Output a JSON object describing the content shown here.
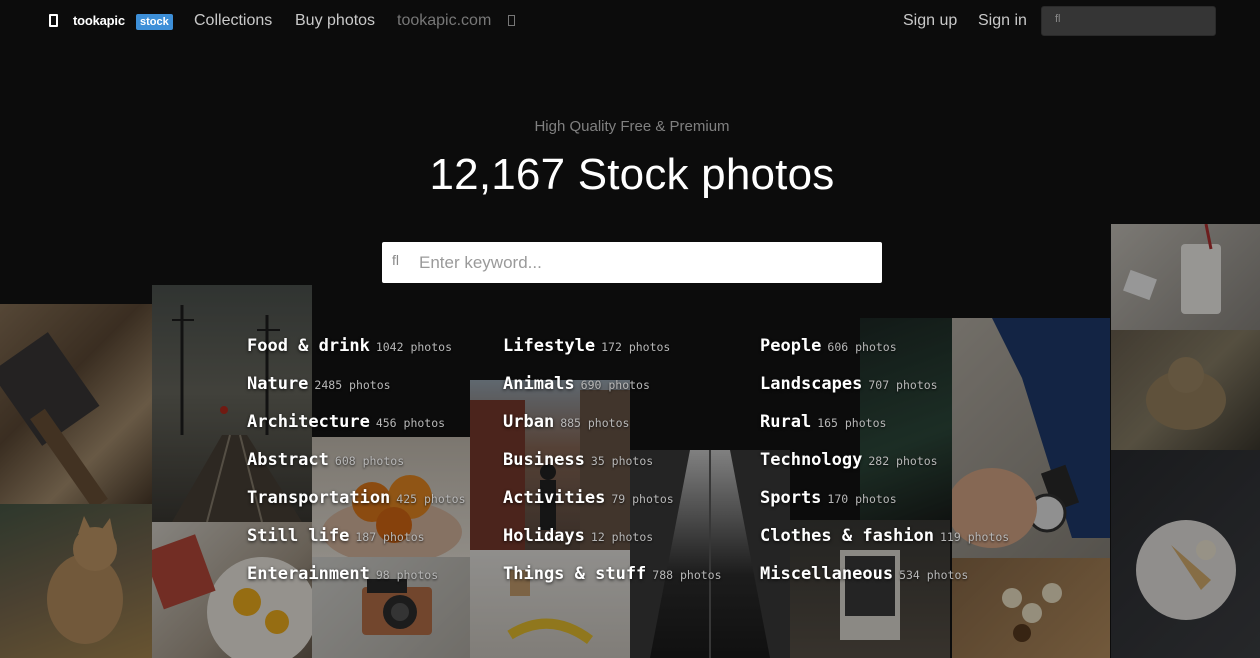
{
  "nav": {
    "brand": "tookapic",
    "badge": "stock",
    "links": [
      "Collections",
      "Buy photos"
    ],
    "external_link": "tookapic.com",
    "sign_up": "Sign up",
    "sign_in": "Sign in"
  },
  "hero": {
    "subtitle": "High Quality Free & Premium",
    "title": "12,167 Stock photos",
    "search_placeholder": "Enter keyword..."
  },
  "categories": [
    [
      {
        "name": "Food & drink",
        "count": "1042 photos"
      },
      {
        "name": "Nature",
        "count": "2485 photos"
      },
      {
        "name": "Architecture",
        "count": "456 photos"
      },
      {
        "name": "Abstract",
        "count": "608 photos"
      },
      {
        "name": "Transportation",
        "count": "425 photos"
      },
      {
        "name": "Still life",
        "count": "187 photos"
      },
      {
        "name": "Enterainment",
        "count": "98 photos"
      }
    ],
    [
      {
        "name": "Lifestyle",
        "count": "172 photos"
      },
      {
        "name": "Animals",
        "count": "690 photos"
      },
      {
        "name": "Urban",
        "count": "885 photos"
      },
      {
        "name": "Business",
        "count": "35 photos"
      },
      {
        "name": "Activities",
        "count": "79 photos"
      },
      {
        "name": "Holidays",
        "count": "12 photos"
      },
      {
        "name": "Things & stuff",
        "count": "788 photos"
      }
    ],
    [
      {
        "name": "People",
        "count": "606 photos"
      },
      {
        "name": "Landscapes",
        "count": "707 photos"
      },
      {
        "name": "Rural",
        "count": "165 photos"
      },
      {
        "name": "Technology",
        "count": "282 photos"
      },
      {
        "name": "Sports",
        "count": "170 photos"
      },
      {
        "name": "Clothes & fashion",
        "count": "119 photos"
      },
      {
        "name": "Miscellaneous",
        "count": "534 photos"
      }
    ]
  ],
  "colors": {
    "background": "#141414",
    "badge": "#3d8fd8",
    "nav_link": "#c9c9c9",
    "muted": "#777777"
  },
  "icons": [
    "logo-icon",
    "external-link-icon",
    "search-icon"
  ]
}
